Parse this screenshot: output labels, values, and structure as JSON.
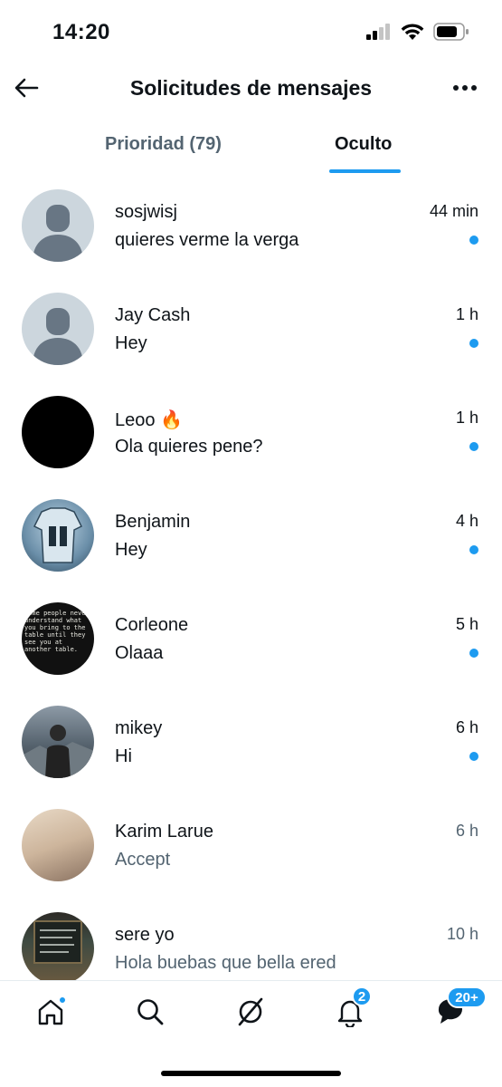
{
  "status_bar": {
    "time": "14:20"
  },
  "header": {
    "title": "Solicitudes de mensajes"
  },
  "tabs": [
    {
      "label": "Prioridad (79)",
      "active": false
    },
    {
      "label": "Oculto",
      "active": true
    }
  ],
  "conversations": [
    {
      "name": "sosjwisj",
      "message": "quieres verme la verga",
      "time": "44 min",
      "unread": true
    },
    {
      "name": "Jay Cash",
      "message": "Hey",
      "time": "1 h",
      "unread": true
    },
    {
      "name": "Leoo 🔥",
      "message": "Ola quieres pene?",
      "time": "1 h",
      "unread": true
    },
    {
      "name": "Benjamin",
      "message": "Hey",
      "time": "4 h",
      "unread": true
    },
    {
      "name": "Corleone",
      "message": "Olaaa",
      "time": "5 h",
      "unread": true,
      "avatar_text": "Some people never understand what you bring to the table until they see you at another table."
    },
    {
      "name": "mikey",
      "message": "Hi",
      "time": "6 h",
      "unread": true
    },
    {
      "name": "Karim Larue",
      "message": "Accept",
      "time": "6 h",
      "unread": false
    },
    {
      "name": "sere yo",
      "message": "Hola buebas que bella ered",
      "time": "10 h",
      "unread": false
    }
  ],
  "bottom_nav": {
    "items": [
      "home-icon",
      "search-icon",
      "grok-icon",
      "bell-icon",
      "messages-icon"
    ],
    "notifications_badge": "2",
    "messages_badge": "20+"
  },
  "colors": {
    "accent": "#1d9bf0",
    "text": "#0f1419",
    "secondary": "#536471"
  }
}
